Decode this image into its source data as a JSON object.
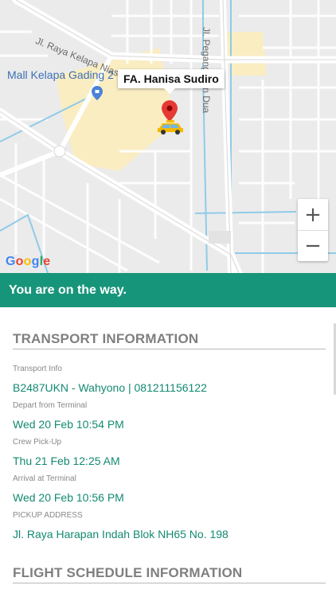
{
  "map": {
    "road_labels": {
      "kelapa_nias": "Jl. Raya Kelapa Nias",
      "pegangsaan": "Jl. Pegangsaan Dua"
    },
    "place_label": "Mall Kelapa Gading 2",
    "popup_title": "FA. Hanisa Sudiro",
    "zoom_in": "+",
    "zoom_out": "−",
    "logo_letters": [
      "G",
      "o",
      "o",
      "g",
      "l",
      "e"
    ],
    "icons": [
      "location-pin-icon",
      "taxi-car-icon",
      "mall-pin-icon"
    ],
    "colors": {
      "marker": "#e53935",
      "car": "#f5b800",
      "water": "#8fcbe8",
      "highlight": "#faedc2"
    }
  },
  "status": {
    "message": "You are on the way.",
    "color": "#17957a"
  },
  "transport": {
    "title": "TRANSPORT INFORMATION",
    "fields": [
      {
        "label": "Transport Info",
        "value": "B2487UKN - Wahyono | 081211156122"
      },
      {
        "label": "Depart from Terminal",
        "value": "Wed 20 Feb 10:54 PM"
      },
      {
        "label": "Crew Pick-Up",
        "value": "Thu 21 Feb 12:25 AM"
      },
      {
        "label": "Arrival at Terminal",
        "value": "Wed 20 Feb 10:56 PM"
      },
      {
        "label": "PICKUP ADDRESS",
        "value": "Jl. Raya Harapan Indah Blok NH65 No. 198"
      }
    ]
  },
  "flight": {
    "title": "FLIGHT SCHEDULE INFORMATION"
  },
  "value_color": "#138a72"
}
